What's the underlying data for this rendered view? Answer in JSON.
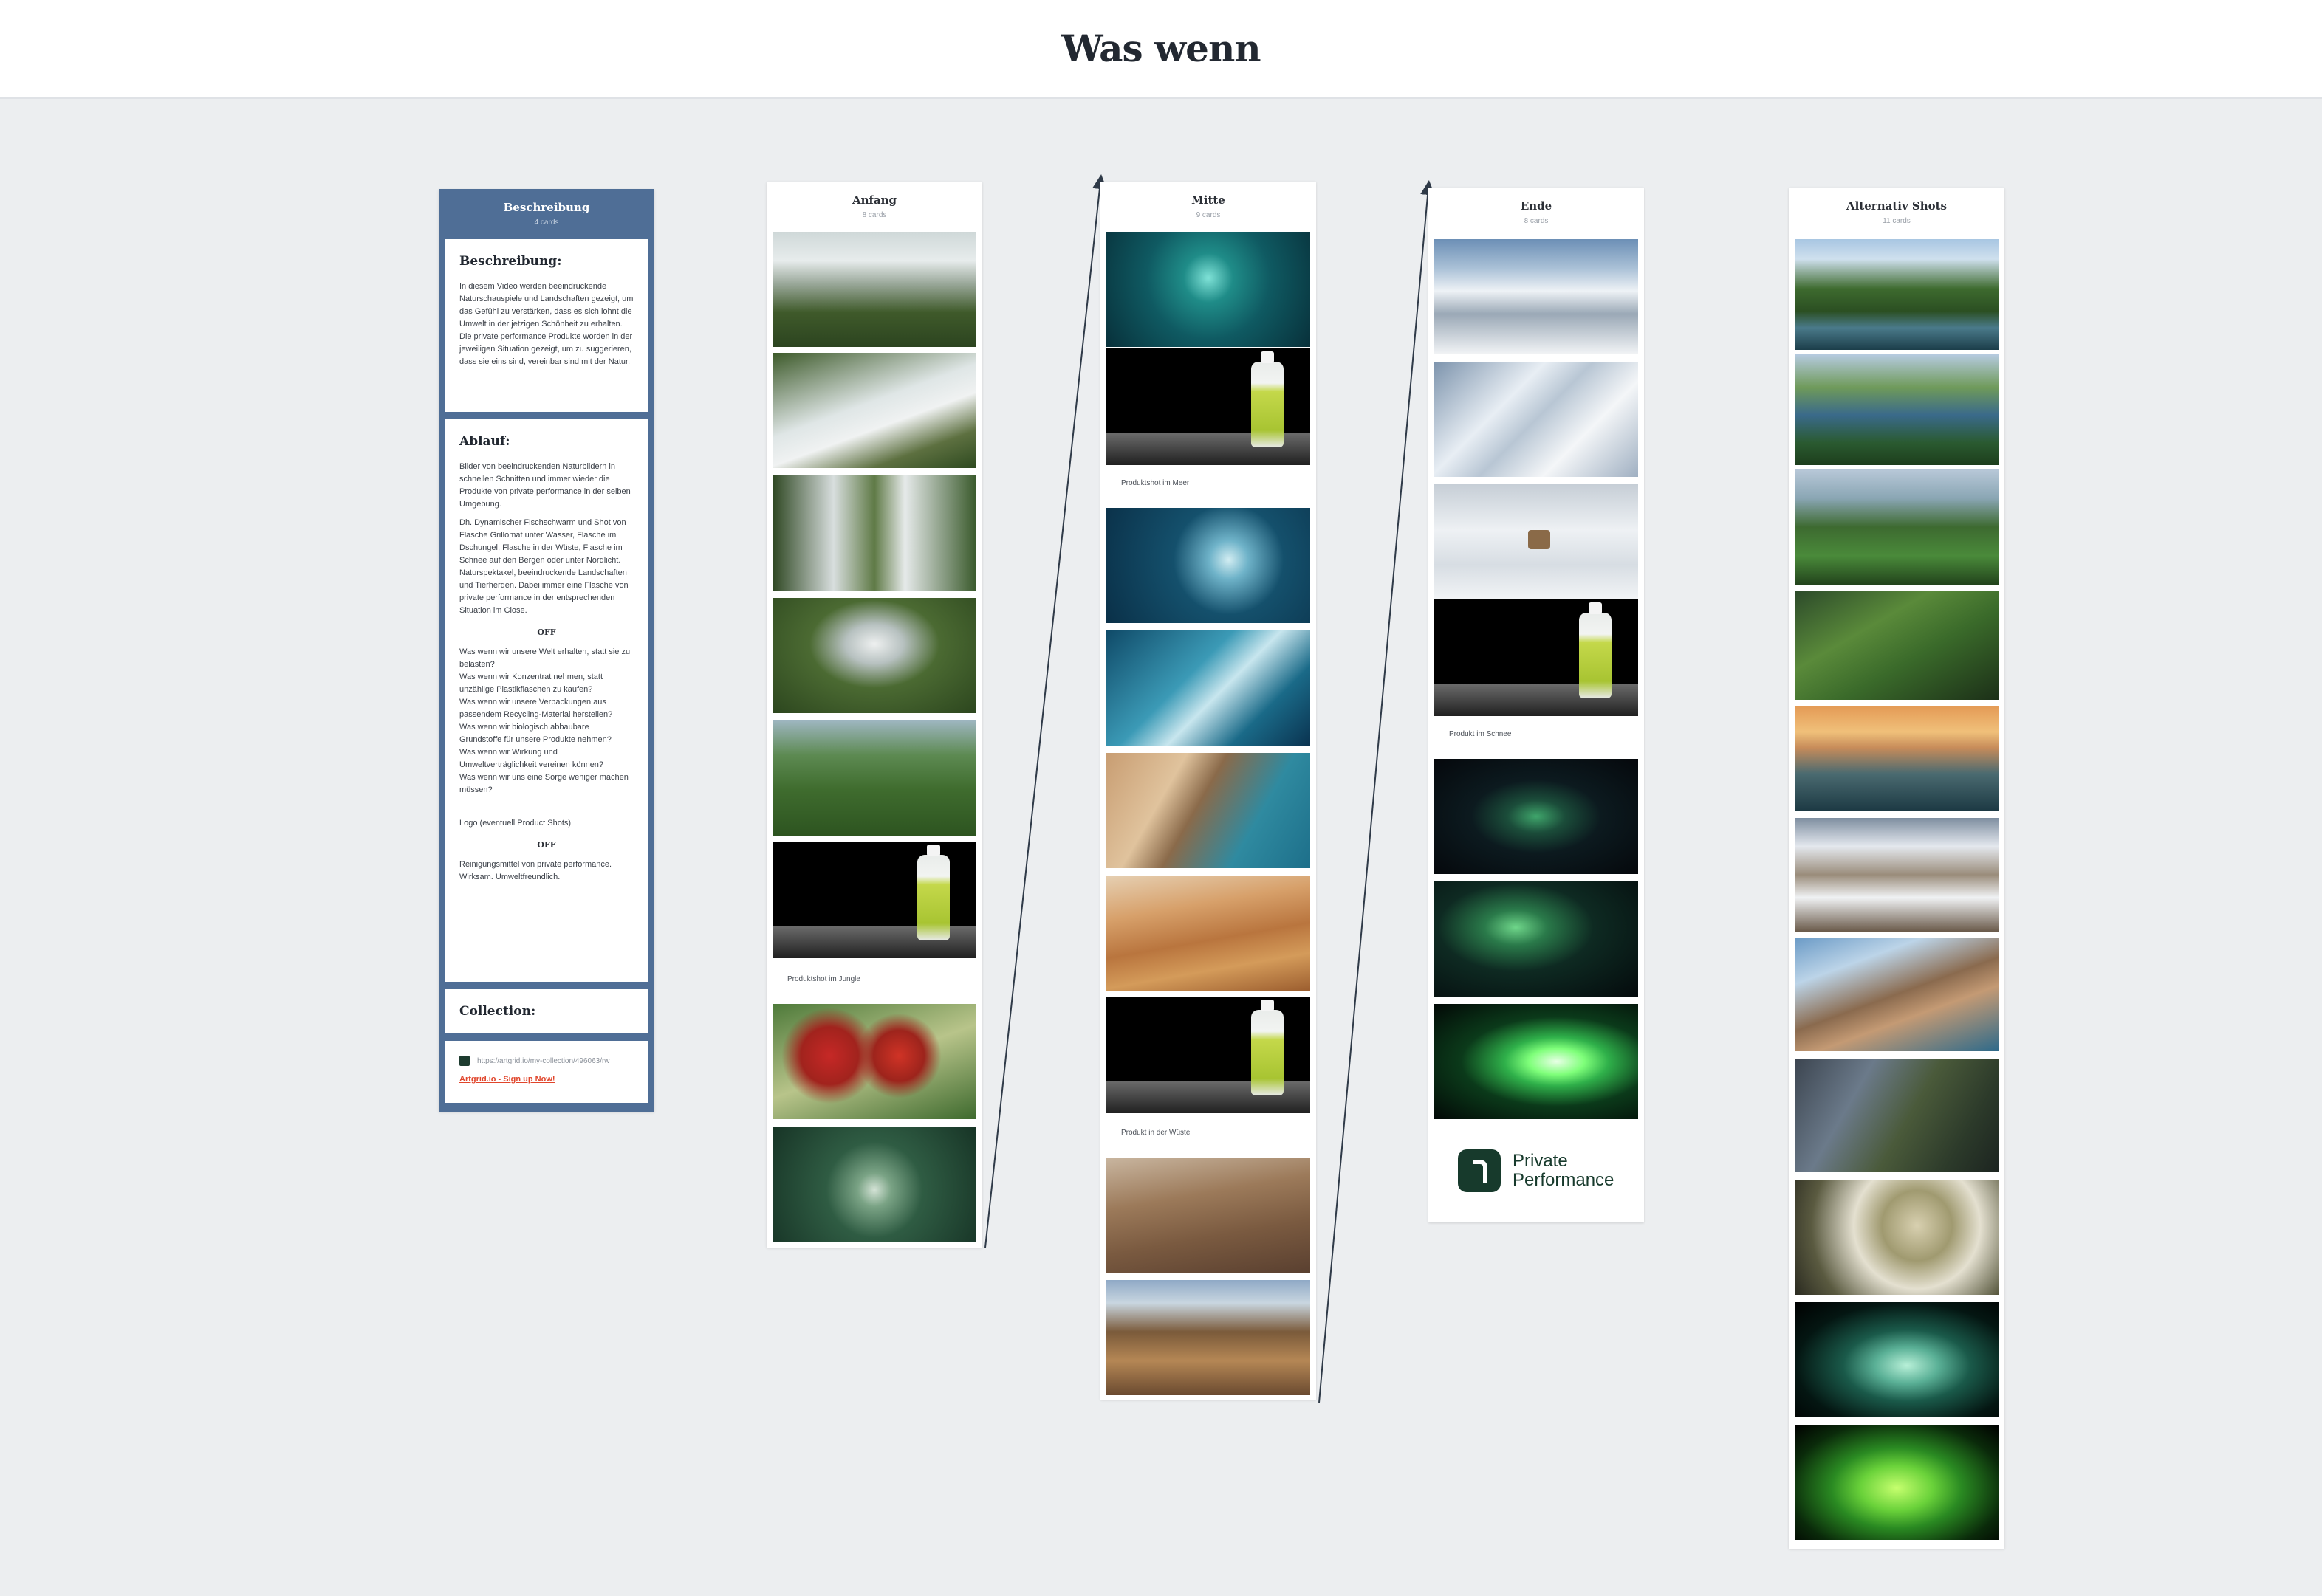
{
  "board": {
    "title": "Was wenn"
  },
  "columns": {
    "beschreibung": {
      "title": "Beschreibung",
      "count": "4 cards",
      "cards": {
        "desc": {
          "heading": "Beschreibung:",
          "text": "In diesem Video werden beeindruckende Naturschauspiele und Landschaften gezeigt, um das Gefühl zu verstärken, dass es sich lohnt die Umwelt in der jetzigen Schönheit zu erhalten. Die private performance Produkte worden in der jeweiligen Situation gezeigt, um zu suggerieren, dass sie eins sind, vereinbar sind mit der Natur."
        },
        "ablauf": {
          "heading": "Ablauf:",
          "p1": "Bilder von beeindruckenden Naturbildern in schnellen Schnitten und immer wieder die Produkte von private performance in der selben Umgebung.",
          "p2": "Dh. Dynamischer Fischschwarm und Shot von Flasche Grillomat unter Wasser, Flasche im Dschungel, Flasche in der Wüste, Flasche im Schnee auf den Bergen oder unter Nordlicht. Naturspektakel, beeindruckende Landschaften und Tierherden. Dabei immer eine Flasche von private performance in der entsprechenden Situation im Close.",
          "off1": "OFF",
          "p3": "Was wenn wir unsere Welt erhalten, statt sie zu belasten?\nWas wenn wir Konzentrat nehmen, statt unzählige Plastikflaschen zu kaufen?\nWas wenn wir unsere Verpackungen aus passendem Recycling-Material herstellen?\nWas wenn wir biologisch abbaubare Grundstoffe für unsere Produkte nehmen?\nWas wenn wir Wirkung und Umweltverträglichkeit vereinen können?\nWas wenn wir uns eine Sorge weniger machen müssen?",
          "p4": "Logo (eventuell Product Shots)",
          "off2": "OFF",
          "p5": "Reinigungsmittel von private performance.\nWirksam. Umweltfreundlich."
        },
        "collection": {
          "heading": "Collection:"
        },
        "link": {
          "url": "https://artgrid.io/my-collection/496063/rw",
          "signup": "Artgrid.io - Sign up Now!"
        }
      }
    },
    "anfang": {
      "title": "Anfang",
      "count": "8 cards",
      "images": [
        "waterfall-aerial",
        "jungle-waterfall",
        "waterfall-cliffs",
        "waterfall-closeup",
        "green-valley",
        "bottle-jungle",
        "parrots",
        "water-drop"
      ],
      "captions": {
        "bottle-jungle": "Produktshot im Jungle"
      }
    },
    "mitte": {
      "title": "Mitte",
      "count": "9 cards",
      "images": [
        "fish-swarm",
        "bottle-sea",
        "whale",
        "ice-water",
        "coast-desert",
        "dunes",
        "bottle-desert",
        "mountain-herd",
        "river-valley"
      ],
      "captions": {
        "bottle-sea": "Produktshot im Meer",
        "bottle-desert": "Produkt in der Wüste"
      }
    },
    "ende": {
      "title": "Ende",
      "count": "8 cards",
      "images": [
        "snow-peaks",
        "snow-ridge",
        "ibex-snow",
        "bottle-snow",
        "aurora-1",
        "aurora-2",
        "aurora-3"
      ],
      "captions": {
        "bottle-snow": "Produkt im Schnee"
      },
      "logo": {
        "line1": "Private",
        "line2": "Performance"
      }
    },
    "alternativ": {
      "title": "Alternativ Shots",
      "count": "11 cards",
      "images": [
        "mountain-lake-1",
        "mountain-lake-2",
        "forest-peaks",
        "green-ridge",
        "sunset-mountains",
        "snowy-tundra",
        "brown-peak",
        "braided-river",
        "lichen-branch",
        "glowing-coral",
        "green-coral"
      ]
    }
  },
  "colors": {
    "description_column": "#4f6e96",
    "background": "#eceef0",
    "link": "#e0452b",
    "logo": "#173a2c"
  },
  "product": {
    "bottle_label": "Grillomat"
  }
}
